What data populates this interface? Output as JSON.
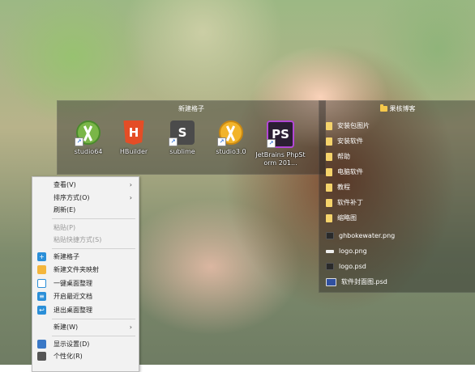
{
  "fence_left": {
    "title": "新建格子",
    "icons": [
      {
        "label": "studio64",
        "icon": "android-studio-icon"
      },
      {
        "label": "HBuilder",
        "icon": "hbuilder-icon"
      },
      {
        "label": "sublime",
        "icon": "sublime-text-icon"
      },
      {
        "label": "studio3.0",
        "icon": "android-studio-icon"
      },
      {
        "label": "JetBrains PhpStorm 201...",
        "icon": "phpstorm-icon"
      }
    ]
  },
  "fence_right": {
    "title": "果核博客",
    "items": [
      {
        "label": "安装包图片",
        "icon": "folder-icon"
      },
      {
        "label": "安装软件",
        "icon": "folder-icon"
      },
      {
        "label": "帮助",
        "icon": "folder-icon"
      },
      {
        "label": "电脑软件",
        "icon": "folder-icon"
      },
      {
        "label": "教程",
        "icon": "folder-icon"
      },
      {
        "label": "软件补丁",
        "icon": "folder-icon"
      },
      {
        "label": "缩略图",
        "icon": "folder-icon"
      },
      {
        "label": "ghbokewater.png",
        "icon": "image-file-icon"
      },
      {
        "label": "logo.png",
        "icon": "image-file-icon"
      },
      {
        "label": "logo.psd",
        "icon": "psd-file-icon"
      },
      {
        "label": "软件封面图.psd",
        "icon": "psd-file-icon"
      }
    ]
  },
  "context_menu": {
    "items": [
      {
        "label": "查看(V)",
        "submenu": true
      },
      {
        "label": "排序方式(O)",
        "submenu": true
      },
      {
        "label": "刷新(E)"
      },
      {
        "label": "粘贴(P)",
        "disabled": true
      },
      {
        "label": "粘贴快捷方式(S)",
        "disabled": true
      },
      {
        "label": "新建格子",
        "icon": "plus-icon"
      },
      {
        "label": "新建文件夹映射",
        "icon": "folder-icon"
      },
      {
        "label": "一键桌面整理",
        "icon": "grid-icon"
      },
      {
        "label": "开启最近文档",
        "icon": "document-icon"
      },
      {
        "label": "退出桌面整理",
        "icon": "exit-icon"
      },
      {
        "label": "新建(W)",
        "submenu": true
      },
      {
        "label": "显示设置(D)",
        "icon": "display-icon"
      },
      {
        "label": "个性化(R)",
        "icon": "personalize-icon"
      }
    ],
    "submenu_arrow": "›"
  },
  "colors": {
    "menu_bg": "#f2f2f2",
    "fence_bg": "rgba(40,40,40,0.42)",
    "folder": "#f5d36b",
    "accent": "#2b8fd8"
  }
}
